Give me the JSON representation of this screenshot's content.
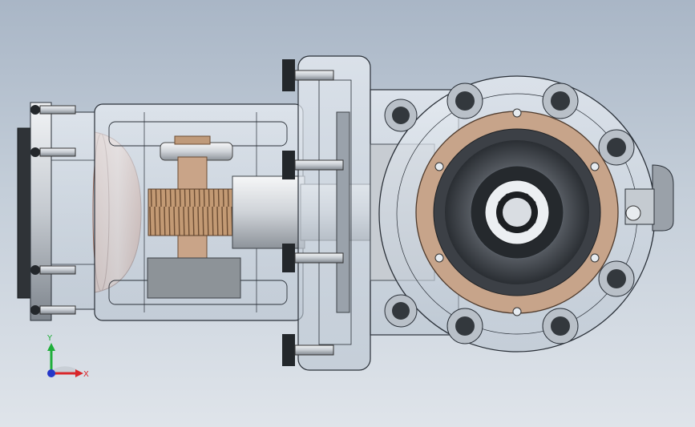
{
  "viewport": {
    "background_top": "#a9b6c6",
    "background_bottom": "#dfe4ea"
  },
  "triad": {
    "y_label": "Y",
    "x_label": "X",
    "y_color": "#1fae3a",
    "x_color": "#d9262a",
    "z_color": "#2537c8"
  },
  "model": {
    "description_icon": "cad-gearbox-assembly",
    "colors": {
      "steel": "#c9ced4",
      "dark_steel": "#3d4247",
      "bronze_ring": "#c7a48a",
      "copper_gear": "#b58d6a",
      "glass_body": "#d7e0ea",
      "edge_line": "#2a3038"
    }
  }
}
